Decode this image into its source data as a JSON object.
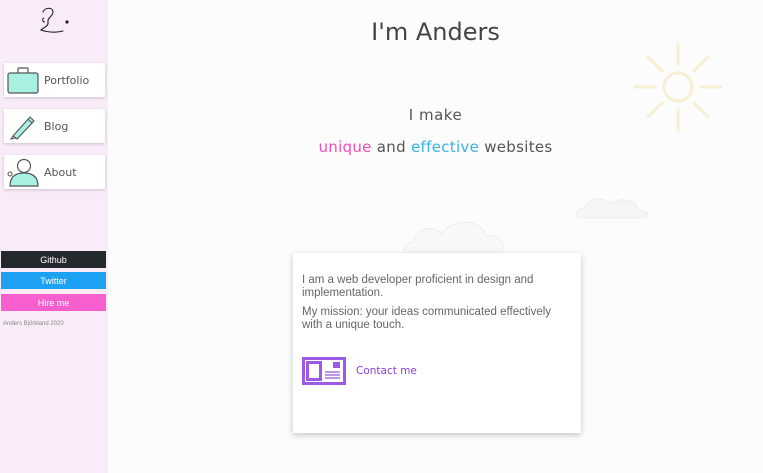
{
  "sidebar": {
    "nav": [
      {
        "label": "Portfolio",
        "icon": "briefcase-icon"
      },
      {
        "label": "Blog",
        "icon": "pencil-icon"
      },
      {
        "label": "About",
        "icon": "person-icon"
      }
    ],
    "links": [
      {
        "label": "Github",
        "color": "#24292e"
      },
      {
        "label": "Twitter",
        "color": "#1da1f2"
      },
      {
        "label": "Hire me",
        "color": "#f75fcf"
      }
    ],
    "footer": "Anders Björkland 2020"
  },
  "hero": {
    "title": "I'm Anders",
    "line1": "I make",
    "word_unique": "unique",
    "word_and": "and",
    "word_effective": "effective",
    "word_websites": "websites"
  },
  "card": {
    "paragraph1": "I am a web developer proficient in design and implementation.",
    "paragraph2": "My mission: your ideas communicated effectively with a unique touch.",
    "contact_label": "Contact me",
    "contact_icon": "contact-card-icon"
  },
  "colors": {
    "sidebar_bg": "#f9ebf8",
    "accent_pink": "#f04dbd",
    "accent_blue": "#39b3e6",
    "accent_purple": "#8b3ddc"
  }
}
